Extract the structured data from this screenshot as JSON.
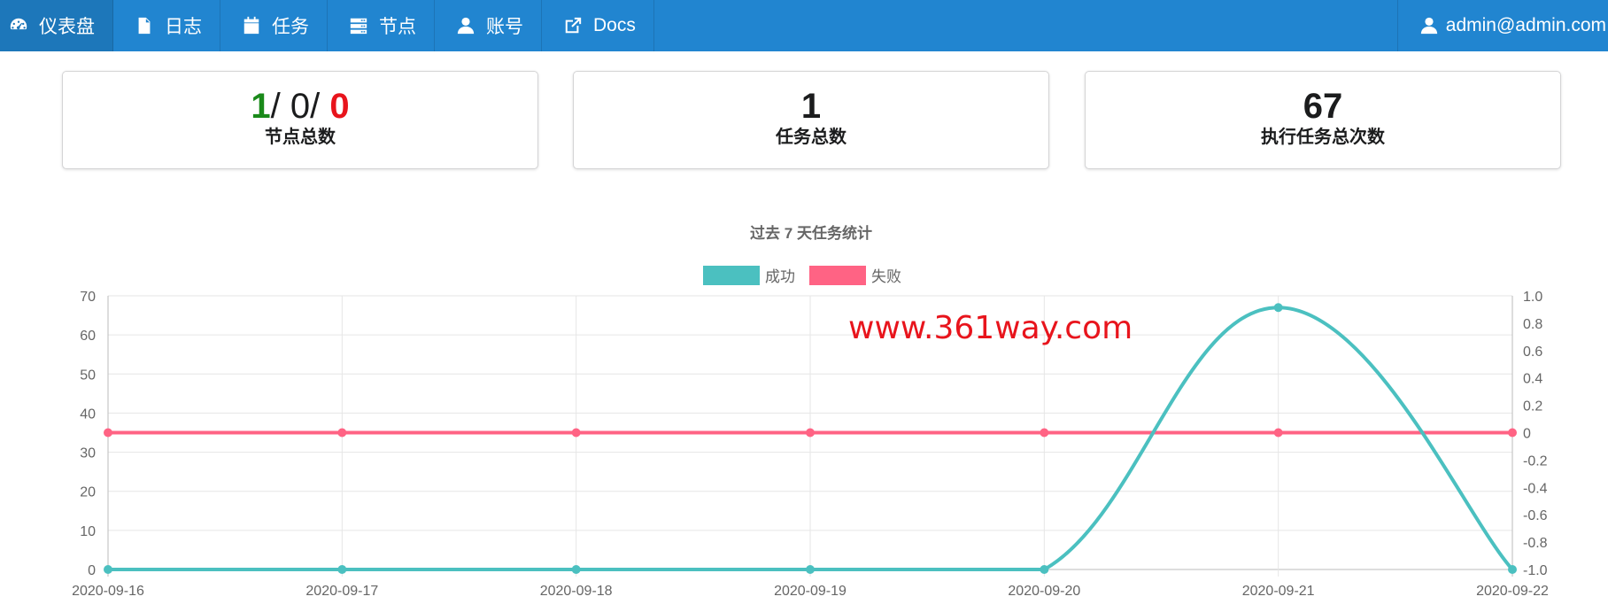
{
  "nav": {
    "items": [
      {
        "label": "仪表盘",
        "icon": "dashboard-icon",
        "active": true
      },
      {
        "label": "日志",
        "icon": "file-icon"
      },
      {
        "label": "任务",
        "icon": "calendar-icon"
      },
      {
        "label": "节点",
        "icon": "server-icon"
      },
      {
        "label": "账号",
        "icon": "user-icon"
      },
      {
        "label": "Docs",
        "icon": "external-link-icon"
      }
    ],
    "user": {
      "label": "admin@admin.com",
      "icon": "user-icon"
    }
  },
  "stats": {
    "nodes": {
      "online": "1",
      "offline": "0",
      "failed": "0",
      "sep": "/",
      "label": "节点总数"
    },
    "tasks": {
      "value": "1",
      "label": "任务总数"
    },
    "runs": {
      "value": "67",
      "label": "执行任务总次数"
    }
  },
  "chart_title": "过去 7 天任务统计",
  "watermark": "www.361way.com",
  "colors": {
    "success": "#4bc0c0",
    "fail": "#ff6384",
    "nav": "#2185d0"
  },
  "chart_data": {
    "type": "line",
    "title": "过去 7 天任务统计",
    "x": [
      "2020-09-16",
      "2020-09-17",
      "2020-09-18",
      "2020-09-19",
      "2020-09-20",
      "2020-09-21",
      "2020-09-22"
    ],
    "series": [
      {
        "name": "成功",
        "values": [
          0,
          0,
          0,
          0,
          0,
          67,
          0
        ],
        "axis": "left",
        "color": "#4bc0c0"
      },
      {
        "name": "失败",
        "values": [
          0,
          0,
          0,
          0,
          0,
          0,
          0
        ],
        "axis": "right",
        "color": "#ff6384"
      }
    ],
    "y_left": {
      "min": 0,
      "max": 70,
      "ticks": [
        "0",
        "10",
        "20",
        "30",
        "40",
        "50",
        "60",
        "70"
      ]
    },
    "y_right": {
      "min": -1,
      "max": 1,
      "ticks": [
        "-1.0",
        "-0.8",
        "-0.6",
        "-0.4",
        "-0.2",
        "0",
        "0.2",
        "0.4",
        "0.6",
        "0.8",
        "1.0"
      ]
    },
    "grid": true,
    "legend_position": "top"
  }
}
